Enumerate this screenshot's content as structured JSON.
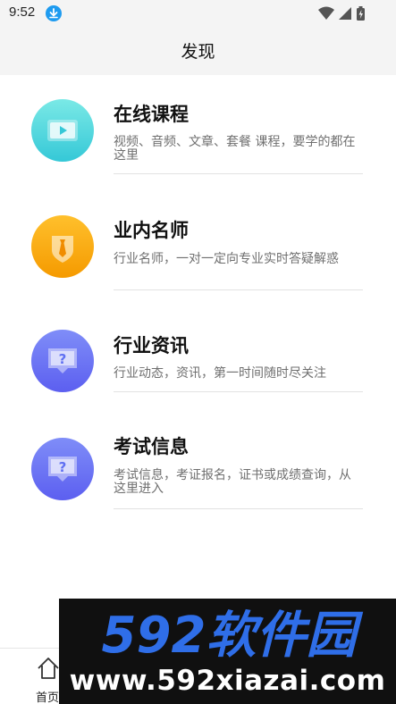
{
  "status_bar": {
    "time": "9:52",
    "icons": [
      "download-notification-icon",
      "wifi-icon",
      "signal-icon",
      "battery-charging-icon"
    ]
  },
  "header": {
    "title": "发现"
  },
  "items": [
    {
      "title": "在线课程",
      "description": "视频、音频、文章、套餐 课程，要学的都在这里",
      "icon": "video-play-icon",
      "icon_colors": [
        "#7ae9e6",
        "#35c8d7"
      ]
    },
    {
      "title": "业内名师",
      "description": "行业名师，一对一定向专业实时答疑解惑",
      "icon": "teacher-tie-icon",
      "icon_colors": [
        "#ffc02c",
        "#f59a00"
      ]
    },
    {
      "title": "行业资讯",
      "description": "行业动态，资讯，第一时间随时尽关注",
      "icon": "question-chat-icon",
      "icon_colors": [
        "#7f8df8",
        "#5c5ff0"
      ]
    },
    {
      "title": "考试信息",
      "description": "考试信息，考证报名，证书或成绩查询，从这里进入",
      "icon": "question-chat-icon",
      "icon_colors": [
        "#7f8df8",
        "#5c5ff0"
      ]
    }
  ],
  "bottom_nav": {
    "home_label": "首页",
    "home_icon": "home-icon"
  },
  "watermark": {
    "logo_text": "592软件园",
    "url": "www.592xiazai.com",
    "logo_color": "#2f6ee8"
  }
}
